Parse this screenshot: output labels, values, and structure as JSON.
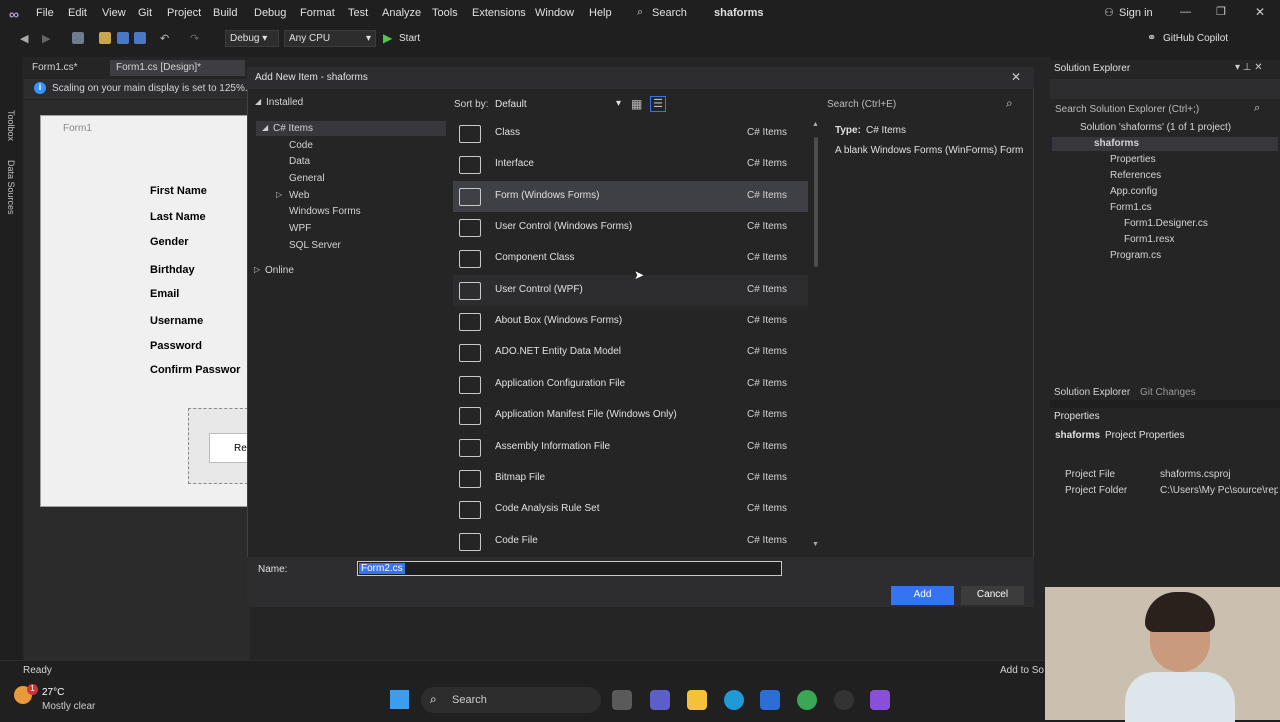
{
  "menu": [
    "File",
    "Edit",
    "View",
    "Git",
    "Project",
    "Build",
    "Debug",
    "Format",
    "Test",
    "Analyze",
    "Tools",
    "Extensions",
    "Window",
    "Help"
  ],
  "menu_search": "Search",
  "solution_name": "shaforms",
  "sign_in": "Sign in",
  "toolbar": {
    "config": "Debug",
    "platform": "Any CPU",
    "start": "Start",
    "copilot": "GitHub Copilot"
  },
  "left_tabs": [
    "Toolbox",
    "Data Sources"
  ],
  "doc_tabs": [
    "Form1.cs*",
    "Form1.cs [Design]*"
  ],
  "infobar": "Scaling on your main display is set to 125%.",
  "form1": {
    "title": "Form1",
    "labels": [
      "First Name",
      "Last Name",
      "Gender",
      "Birthday",
      "Email",
      "Username",
      "Password",
      "Confirm Passwor"
    ],
    "button_partial": "Re"
  },
  "dialog": {
    "title": "Add New Item - shaforms",
    "installed": "Installed",
    "tree": [
      "C# Items",
      "Code",
      "Data",
      "General",
      "Web",
      "Windows Forms",
      "WPF",
      "SQL Server",
      "Online"
    ],
    "sort_label": "Sort by:",
    "sort_value": "Default",
    "search_placeholder": "Search (Ctrl+E)",
    "items": [
      {
        "name": "Class",
        "cat": "C# Items"
      },
      {
        "name": "Interface",
        "cat": "C# Items"
      },
      {
        "name": "Form (Windows Forms)",
        "cat": "C# Items"
      },
      {
        "name": "User Control (Windows Forms)",
        "cat": "C# Items"
      },
      {
        "name": "Component Class",
        "cat": "C# Items"
      },
      {
        "name": "User Control (WPF)",
        "cat": "C# Items"
      },
      {
        "name": "About Box (Windows Forms)",
        "cat": "C# Items"
      },
      {
        "name": "ADO.NET Entity Data Model",
        "cat": "C# Items"
      },
      {
        "name": "Application Configuration File",
        "cat": "C# Items"
      },
      {
        "name": "Application Manifest File (Windows Only)",
        "cat": "C# Items"
      },
      {
        "name": "Assembly Information File",
        "cat": "C# Items"
      },
      {
        "name": "Bitmap File",
        "cat": "C# Items"
      },
      {
        "name": "Code Analysis Rule Set",
        "cat": "C# Items"
      },
      {
        "name": "Code File",
        "cat": "C# Items"
      }
    ],
    "selected_index": 2,
    "type_label": "Type:",
    "type_value": "C# Items",
    "description": "A blank Windows Forms (WinForms) Form",
    "name_label": "Name:",
    "name_value": "Form2.cs",
    "add": "Add",
    "cancel": "Cancel"
  },
  "solution_explorer": {
    "title": "Solution Explorer",
    "search": "Search Solution Explorer (Ctrl+;)",
    "items": [
      "Solution 'shaforms' (1 of 1 project)",
      "shaforms",
      "Properties",
      "References",
      "App.config",
      "Form1.cs",
      "Form1.Designer.cs",
      "Form1.resx",
      "Program.cs"
    ],
    "tabs": [
      "Solution Explorer",
      "Git Changes"
    ]
  },
  "properties": {
    "title": "Properties",
    "object": "shaforms",
    "object_type": "Project Properties",
    "rows": [
      {
        "key": "Project File",
        "value": "shaforms.csproj"
      },
      {
        "key": "Project Folder",
        "value": "C:\\Users\\My Pc\\source\\rep"
      }
    ]
  },
  "status": {
    "text": "Ready",
    "right": "Add to So"
  },
  "taskbar": {
    "temp": "27°C",
    "weather": "Mostly clear",
    "search": "Search",
    "notif": "1"
  },
  "colors": {
    "accent": "#3574f0",
    "vs_purple": "#8a4fd8",
    "selected_row": "#3f3f46"
  }
}
